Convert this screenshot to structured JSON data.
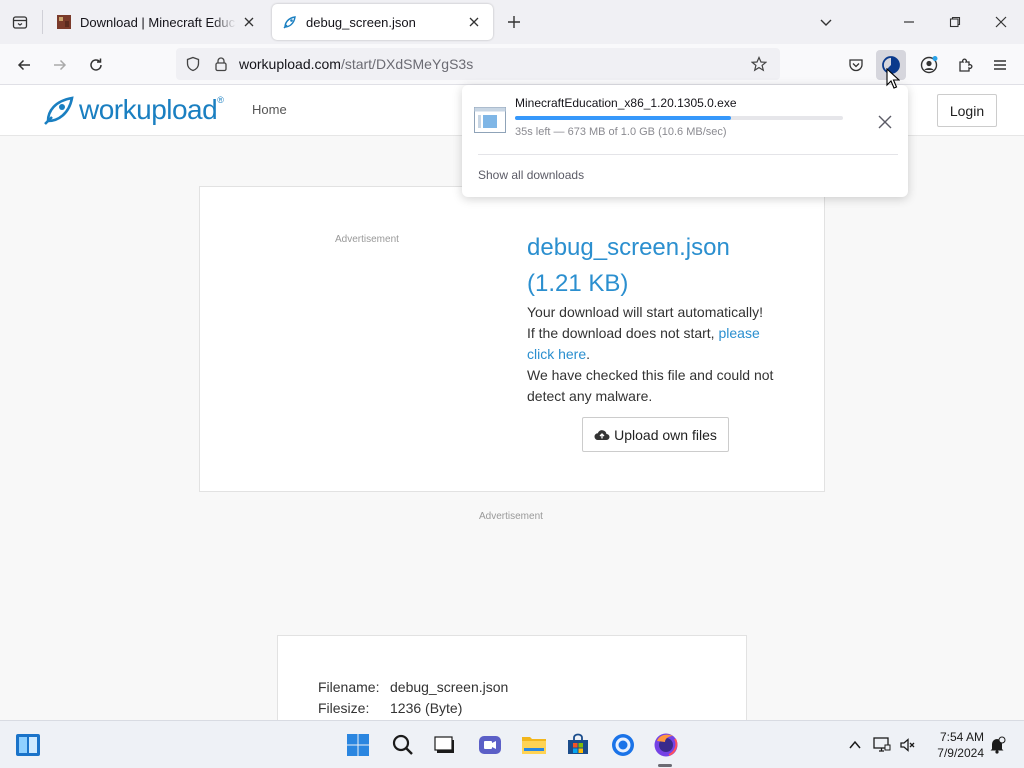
{
  "browser": {
    "tabs": [
      {
        "title": "Download | Minecraft Educatio",
        "favicon": "minecraft-favicon",
        "active": false
      },
      {
        "title": "debug_screen.json",
        "favicon": "workupload-rocket-favicon",
        "active": true
      }
    ],
    "url": {
      "domain": "workupload.com",
      "path": "/start/DXdSMeYgS3s"
    }
  },
  "site": {
    "logo_text": "workupload",
    "logo_reg": "®",
    "nav_home": "Home",
    "login_label": "Login"
  },
  "main": {
    "ad_label_top": "Advertisement",
    "ad_label_mid": "Advertisement",
    "file_name": "debug_screen.json",
    "file_size": "(1.21 KB)",
    "line_auto": "Your download will start automatically!",
    "line_notstart": "If the download does not start,",
    "link_click": "please click here",
    "line_period": ".",
    "line_malware": "We have checked this file and could not detect any malware.",
    "upload_label": "Upload own files"
  },
  "details": {
    "filename_label": "Filename:",
    "filename_value": "debug_screen.json",
    "filesize_label": "Filesize:",
    "filesize_value": "1236 (Byte)"
  },
  "downloads_panel": {
    "item_name": "MinecraftEducation_x86_1.20.1305.0.exe",
    "progress_fraction": 0.66,
    "status": "35s left — 673 MB of 1.0 GB (10.6 MB/sec)",
    "show_all": "Show all downloads"
  },
  "taskbar": {
    "time": "7:54 AM",
    "date": "7/9/2024"
  },
  "colors": {
    "brand": "#1a7fc1",
    "link": "#2b8fcf",
    "progress": "#0a84ff"
  }
}
